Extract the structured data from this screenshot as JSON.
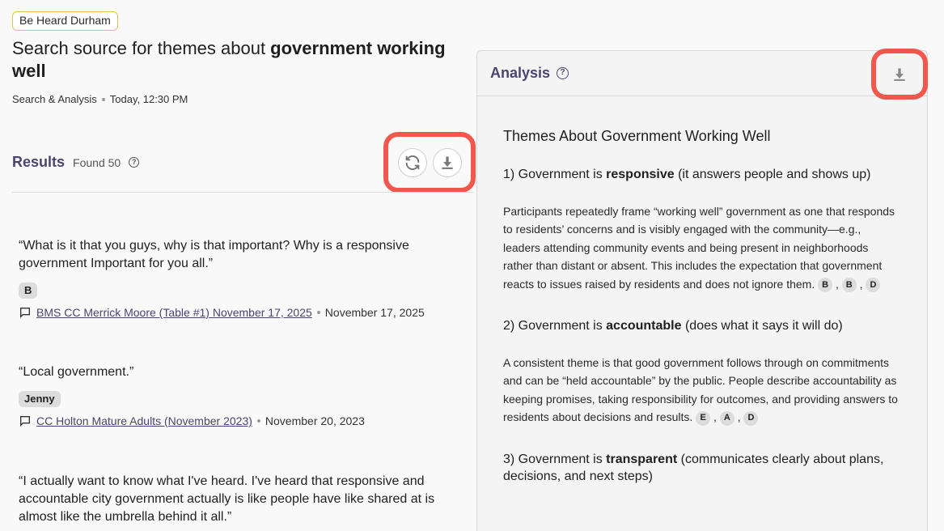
{
  "header": {
    "tag": "Be Heard Durham",
    "title_prefix": "Search source for themes about ",
    "title_bold": "government working well",
    "meta_type": "Search & Analysis",
    "meta_time": "Today, 12:30 PM"
  },
  "results": {
    "title": "Results",
    "count": "Found 50",
    "items": [
      {
        "quote": "“What is it that you guys, why is that important? Why is a responsive government Important for you all.”",
        "speaker": "B",
        "source": "BMS CC Merrick Moore (Table #1) November 17, 2025",
        "date": "November 17, 2025"
      },
      {
        "quote": "“Local government.”",
        "speaker": "Jenny",
        "source": "CC Holton Mature Adults (November 2023)",
        "date": "November 20, 2023"
      },
      {
        "quote": "“I actually want to know what I've heard. I've heard that responsive and accountable city government actually is like people have like shared at is almost like the umbrella behind it all.”"
      }
    ]
  },
  "analysis": {
    "title": "Analysis",
    "heading": "Themes About Government Working Well",
    "themes": [
      {
        "prefix": "1) Government is ",
        "bold": "responsive",
        "suffix": " (it answers people and shows up)",
        "text": "Participants repeatedly frame “working well” government as one that responds to residents’ concerns and is visibly engaged with the community—e.g., leaders attending community events and being present in neighborhoods rather than distant or absent. This includes the expectation that government reacts to issues raised by residents and does not ignore them.",
        "cites": [
          "B",
          "B",
          "D"
        ]
      },
      {
        "prefix": "2) Government is ",
        "bold": "accountable",
        "suffix": " (does what it says it will do)",
        "text": "A consistent theme is that good government follows through on commitments and can be “held accountable” by the public. People describe accountability as keeping promises, taking responsibility for outcomes, and providing answers to residents about decisions and results.",
        "cites": [
          "E",
          "A",
          "D"
        ]
      },
      {
        "prefix": "3) Government is ",
        "bold": "transparent",
        "suffix": " (communicates clearly about plans, decisions, and next steps)"
      }
    ]
  },
  "icons": {
    "refresh": "refresh-icon",
    "download": "download-icon",
    "help": "help-icon",
    "comment": "comment-icon"
  },
  "colors": {
    "accent": "#4a4570",
    "highlight": "#f2574e",
    "tag_border": "#e2c256"
  }
}
